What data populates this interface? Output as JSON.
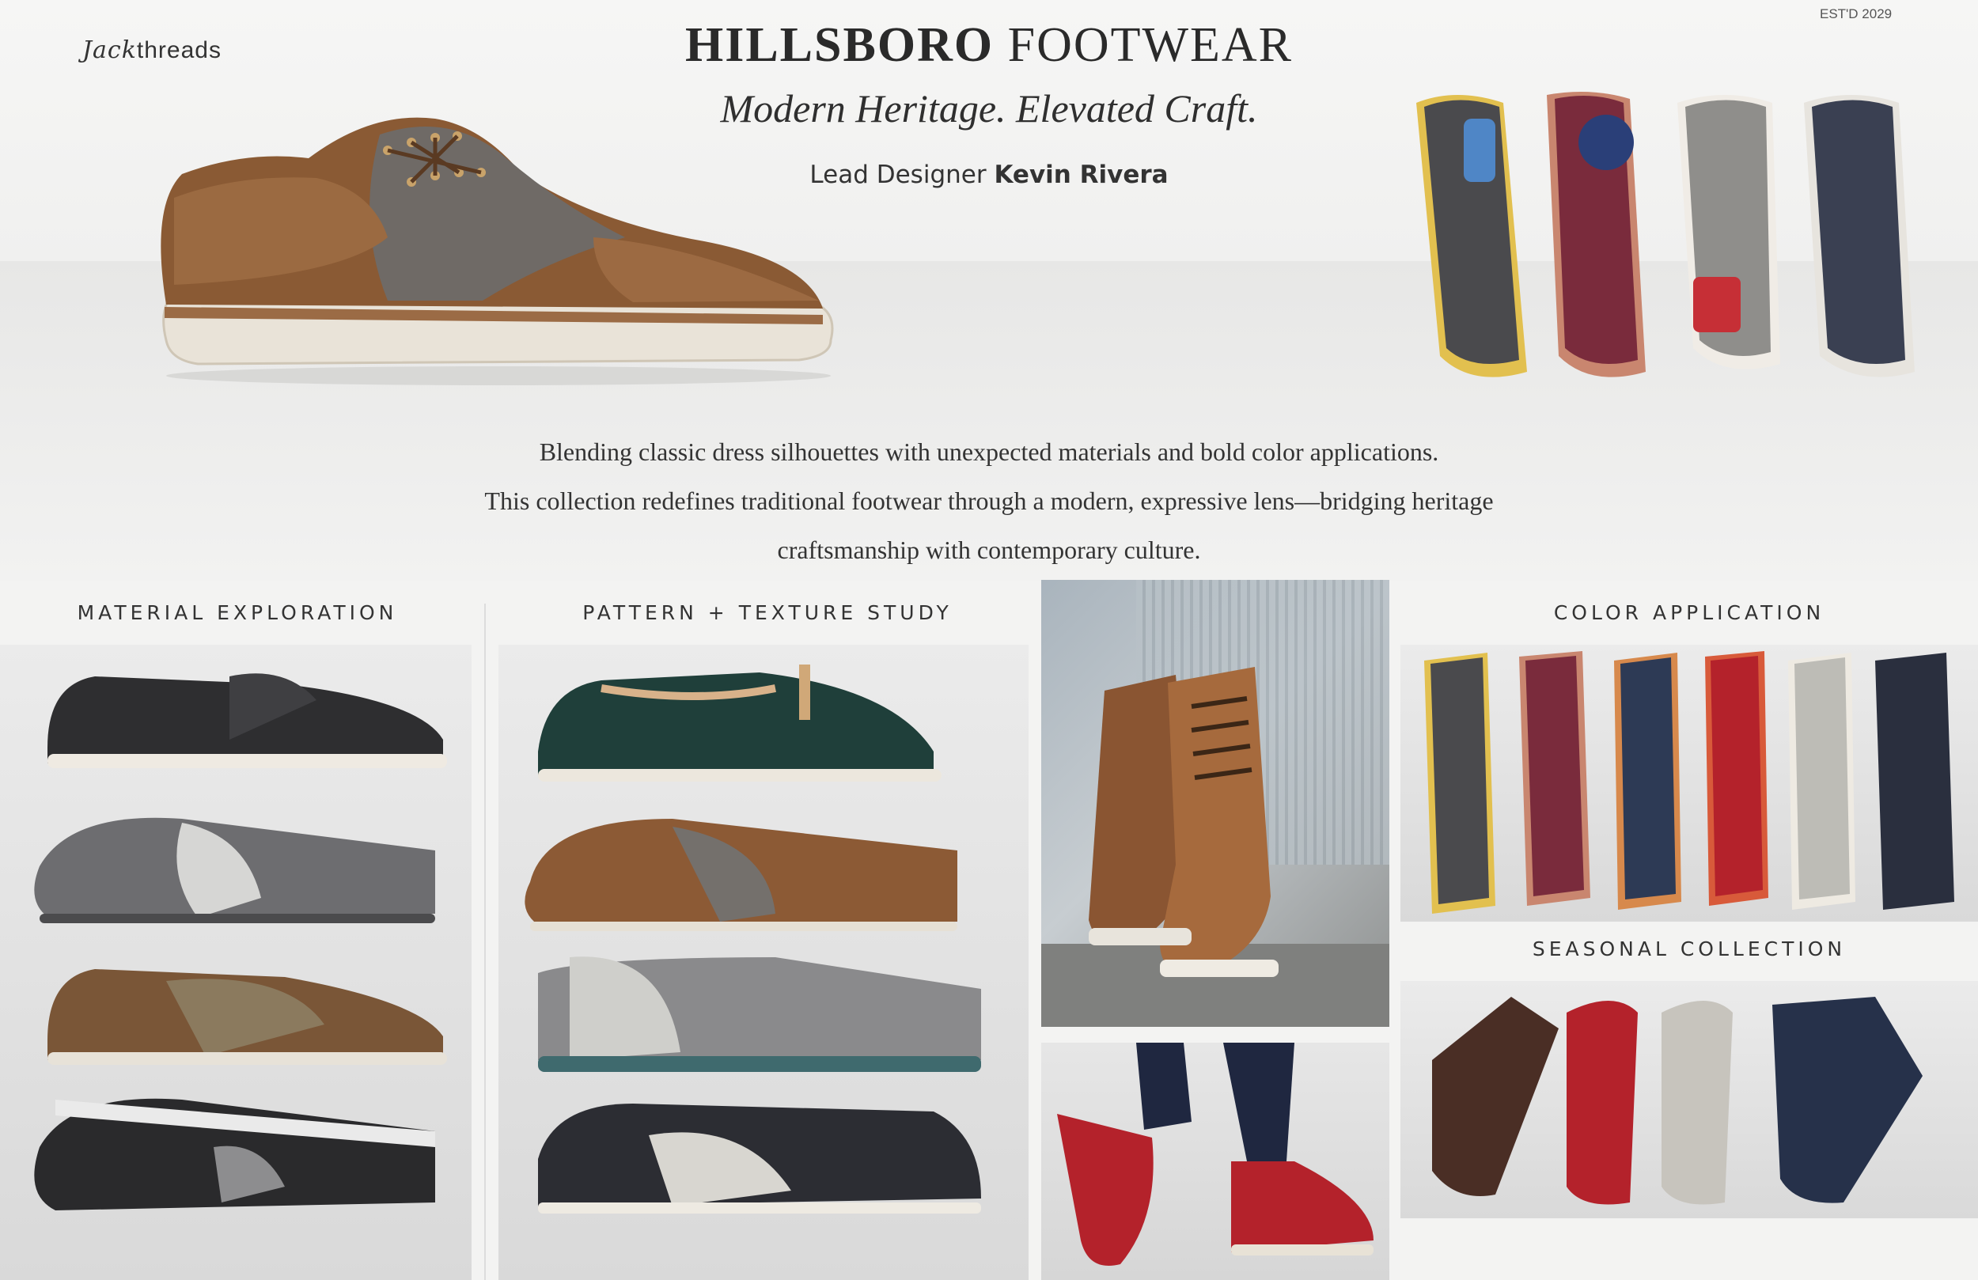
{
  "brand": {
    "logo_script": "Jack",
    "logo_rest": "threads",
    "established": "EST'D 2029"
  },
  "header": {
    "title_part1": "HILLSBORO",
    "title_part2": "FOOTWEAR",
    "tagline": "Modern Heritage. Elevated Craft.",
    "designer_prefix": "Lead Designer",
    "designer_name": "Kevin Rivera"
  },
  "description": {
    "line1": "Blending classic dress silhouettes with unexpected materials and bold color applications.",
    "line2": "This collection redefines traditional footwear through a modern, expressive lens—bridging heritage",
    "line3": "craftsmanship with contemporary culture."
  },
  "sections": {
    "material": "MATERIAL EXPLORATION",
    "pattern": "PATTERN + TEXTURE STUDY",
    "color": "COLOR APPLICATION",
    "seasonal": "SEASONAL COLLECTION"
  },
  "colors": {
    "background": "#f3f3f2",
    "text": "#2b2b2b",
    "cognac": "#8a5a34",
    "burgundy": "#7a2b3c",
    "navy": "#2d3a55",
    "red": "#b4222b"
  },
  "icons": [
    "wingtip-oxford",
    "loafer",
    "chelsea-boot",
    "derby-shoe"
  ]
}
